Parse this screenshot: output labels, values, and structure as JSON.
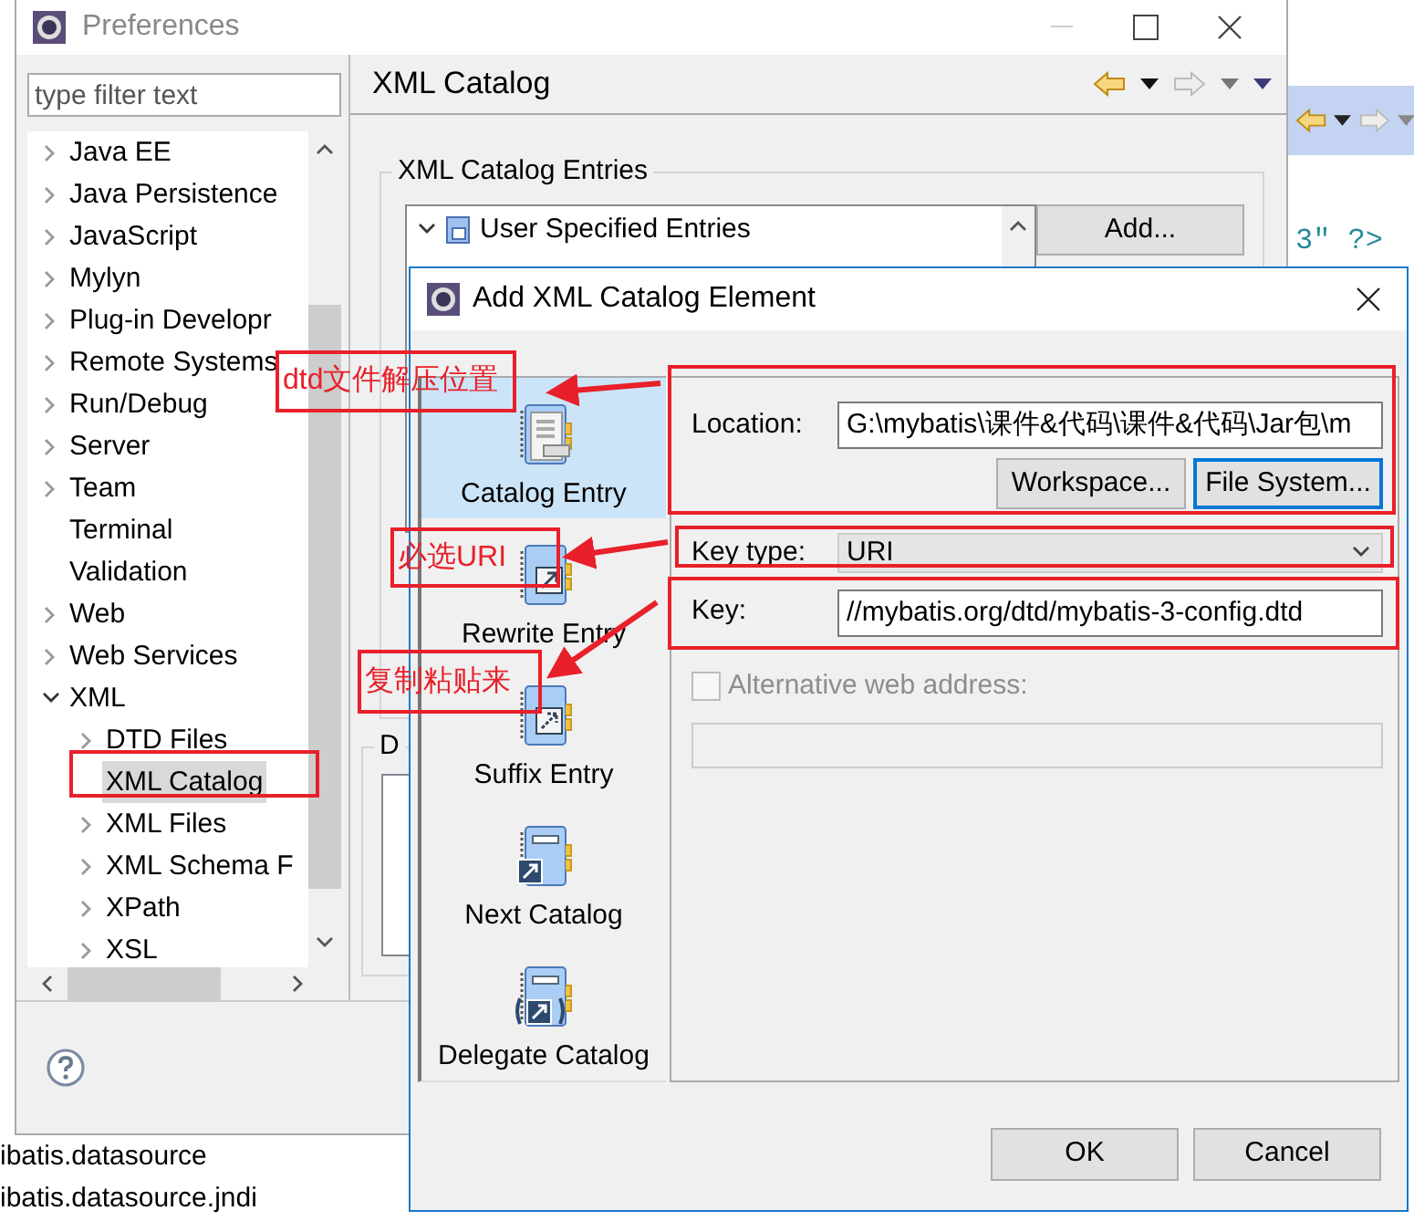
{
  "editor": {
    "code_fragment": "3\" ?>",
    "lines": [
      "ibatis.datasource",
      "ibatis.datasource.jndi"
    ]
  },
  "preferences": {
    "title": "Preferences",
    "filter": {
      "placeholder": "type filter text"
    },
    "tree": [
      {
        "label": "Java EE",
        "expanded": false,
        "selected": false
      },
      {
        "label": "Java Persistence",
        "expanded": false,
        "selected": false
      },
      {
        "label": "JavaScript",
        "expanded": false,
        "selected": false
      },
      {
        "label": "Mylyn",
        "expanded": false,
        "selected": false
      },
      {
        "label": "Plug-in Developr",
        "expanded": false,
        "selected": false
      },
      {
        "label": "Remote Systems",
        "expanded": false,
        "selected": false
      },
      {
        "label": "Run/Debug",
        "expanded": false,
        "selected": false
      },
      {
        "label": "Server",
        "expanded": false,
        "selected": false
      },
      {
        "label": "Team",
        "expanded": false,
        "selected": false
      },
      {
        "label": "Terminal",
        "selected": false
      },
      {
        "label": "Validation",
        "selected": false
      },
      {
        "label": "Web",
        "expanded": false,
        "selected": false
      },
      {
        "label": "Web Services",
        "expanded": false,
        "selected": false
      },
      {
        "label": "XML",
        "expanded": true,
        "selected": false,
        "children": [
          {
            "label": "DTD Files",
            "expanded": false,
            "selected": false
          },
          {
            "label": "XML Catalog",
            "selected": true
          },
          {
            "label": "XML Files",
            "expanded": false,
            "selected": false
          },
          {
            "label": "XML Schema F",
            "expanded": false,
            "selected": false
          },
          {
            "label": "XPath",
            "expanded": false,
            "selected": false
          },
          {
            "label": "XSL",
            "expanded": false,
            "selected": false
          }
        ]
      }
    ],
    "page": {
      "title": "XML Catalog",
      "entries_group": {
        "label": "XML Catalog Entries",
        "tree": [
          {
            "label": "User Specified Entries",
            "expanded": true
          }
        ],
        "add_button": "Add..."
      },
      "second_group": {
        "label": "D"
      }
    }
  },
  "dialog": {
    "title": "Add XML Catalog Element",
    "entry_types": [
      {
        "kind": "catalog",
        "label": "Catalog Entry",
        "selected": true
      },
      {
        "kind": "rewrite",
        "label": "Rewrite Entry",
        "selected": false
      },
      {
        "kind": "suffix",
        "label": "Suffix Entry",
        "selected": false
      },
      {
        "kind": "next",
        "label": "Next Catalog",
        "selected": false
      },
      {
        "kind": "delegate",
        "label": "Delegate Catalog",
        "selected": false
      }
    ],
    "location": {
      "label": "Location:",
      "value": "G:\\mybatis\\课件&代码\\课件&代码\\Jar包\\m"
    },
    "location_buttons": [
      {
        "label": "Workspace...",
        "focused": false
      },
      {
        "label": "File System...",
        "focused": true
      }
    ],
    "key_type": {
      "label": "Key type:",
      "value": "URI"
    },
    "key": {
      "label": "Key:",
      "value": "//mybatis.org/dtd/mybatis-3-config.dtd"
    },
    "alternative": {
      "label": "Alternative web address:",
      "checked": false,
      "disabled": true
    },
    "buttons": [
      "OK",
      "Cancel"
    ]
  },
  "annotations": [
    {
      "text": "dtd文件解压位置"
    },
    {
      "text": "必选URI"
    },
    {
      "text": "复制粘贴来"
    }
  ]
}
